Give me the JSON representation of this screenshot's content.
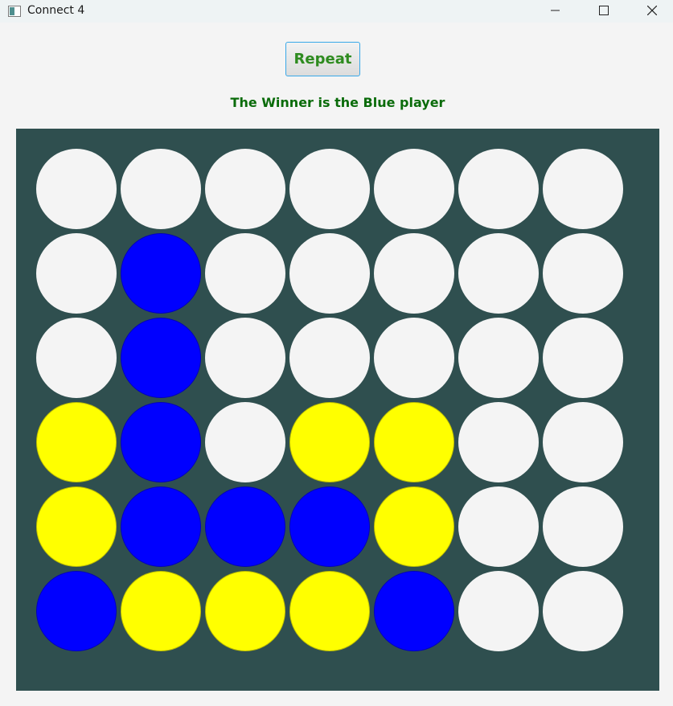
{
  "window": {
    "title": "Connect 4"
  },
  "controls": {
    "repeat_label": "Repeat"
  },
  "status": {
    "message": "The Winner is the Blue player"
  },
  "colors": {
    "board": "#2f4f4f",
    "empty": "#f4f4f4",
    "blue": "#0000ff",
    "yellow": "#ffff00",
    "accent_text": "#0a6b0a"
  },
  "board": {
    "rows": 6,
    "cols": 7,
    "cells": [
      [
        "empty",
        "empty",
        "empty",
        "empty",
        "empty",
        "empty",
        "empty"
      ],
      [
        "empty",
        "blue",
        "empty",
        "empty",
        "empty",
        "empty",
        "empty"
      ],
      [
        "empty",
        "blue",
        "empty",
        "empty",
        "empty",
        "empty",
        "empty"
      ],
      [
        "yellow",
        "blue",
        "empty",
        "yellow",
        "yellow",
        "empty",
        "empty"
      ],
      [
        "yellow",
        "blue",
        "blue",
        "blue",
        "yellow",
        "empty",
        "empty"
      ],
      [
        "blue",
        "yellow",
        "yellow",
        "yellow",
        "blue",
        "empty",
        "empty"
      ]
    ]
  }
}
